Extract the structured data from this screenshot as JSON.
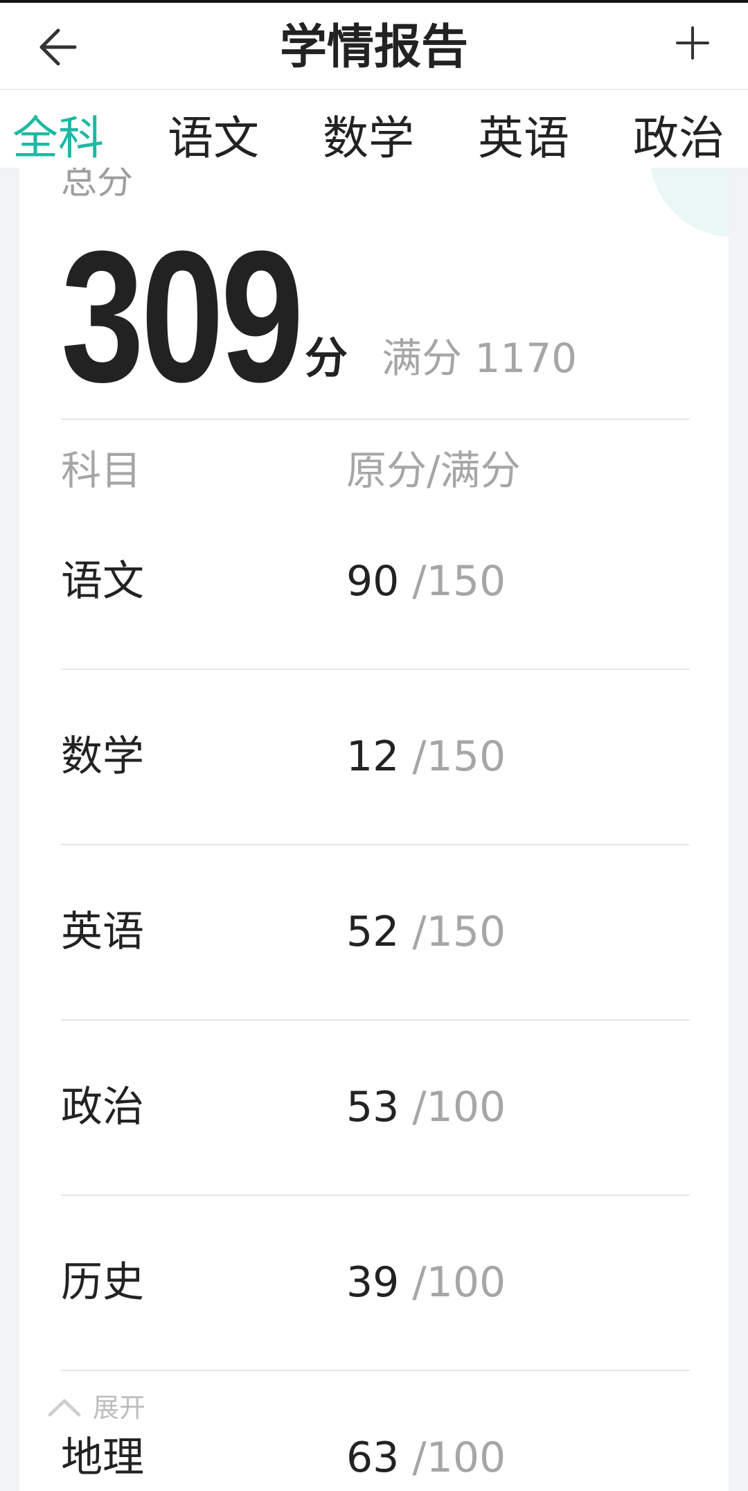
{
  "header": {
    "title": "学情报告",
    "back_icon": "arrow-left-icon",
    "add_icon": "plus-icon"
  },
  "tabs": [
    {
      "label": "全科",
      "active": true
    },
    {
      "label": "语文",
      "active": false
    },
    {
      "label": "数学",
      "active": false
    },
    {
      "label": "英语",
      "active": false
    },
    {
      "label": "政治",
      "active": false
    }
  ],
  "summary": {
    "total_label": "总分",
    "total_score": "309",
    "total_unit": "分",
    "full_label": "满分 1170"
  },
  "table": {
    "col_subject": "科目",
    "col_score": "原分/满分",
    "rows": [
      {
        "subject": "语文",
        "raw": "90",
        "full": " /150"
      },
      {
        "subject": "数学",
        "raw": "12",
        "full": " /150"
      },
      {
        "subject": "英语",
        "raw": "52",
        "full": " /150"
      },
      {
        "subject": "政治",
        "raw": "53",
        "full": " /100"
      },
      {
        "subject": "历史",
        "raw": "39",
        "full": " /100"
      },
      {
        "subject": "地理",
        "raw": "63",
        "full": " /100"
      }
    ]
  },
  "expand": {
    "label": "展开",
    "icon": "chevron-up-icon"
  },
  "colors": {
    "accent": "#1fb8a4",
    "text_primary": "#222222",
    "text_secondary": "#a6a6a6"
  }
}
